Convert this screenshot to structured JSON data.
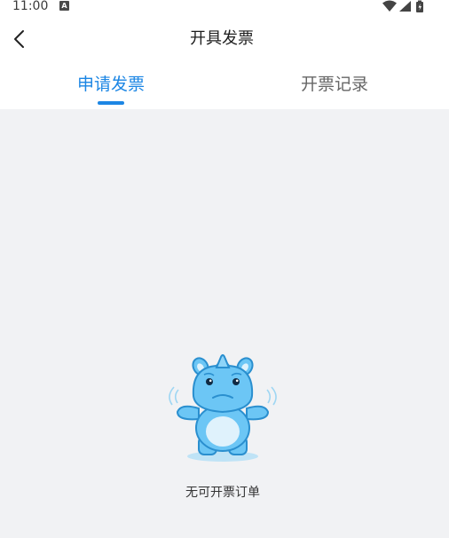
{
  "status_bar": {
    "time": "11:00",
    "notification_icon": "a-icon",
    "icons": [
      "wifi-icon",
      "signal-icon",
      "battery-icon"
    ]
  },
  "header": {
    "title": "开具发票",
    "back_icon": "chevron-left-icon"
  },
  "tabs": [
    {
      "label": "申请发票",
      "active": true
    },
    {
      "label": "开票记录",
      "active": false
    }
  ],
  "empty_state": {
    "illustration": "rhino-mascot",
    "message": "无可开票订单"
  },
  "colors": {
    "accent": "#1c86e4",
    "background": "#f1f2f4",
    "mascot": "#6cc6f5"
  }
}
